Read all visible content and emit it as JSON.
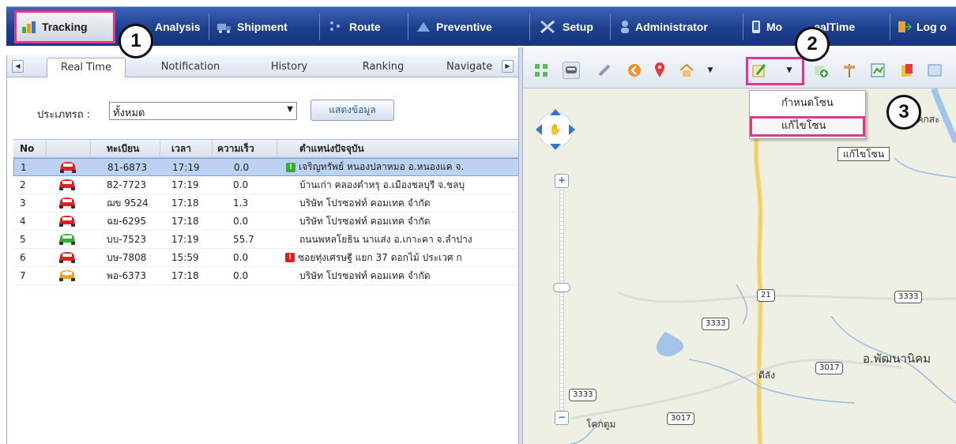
{
  "menu": {
    "tracking": "Tracking",
    "analysis": "Analysis",
    "shipment": "Shipment",
    "route": "Route",
    "preventive": "Preventive",
    "setup": "Setup",
    "administrator": "Administrator",
    "mobile_realtime_a": "Mo",
    "mobile_realtime_b": "ealTime",
    "logout": "Log o"
  },
  "callouts": {
    "one": "1",
    "two": "2",
    "three": "3"
  },
  "tabs": [
    "Real Time",
    "Notification",
    "History",
    "Ranking",
    "Navigate"
  ],
  "filter": {
    "label": "ประเภทรถ :",
    "selected": "ทั้งหมด",
    "button": "แสดงข้อมูล"
  },
  "grid": {
    "headers": {
      "no": "No",
      "plate": "ทะเบียน",
      "time": "เวลา",
      "speed": "ความเร็ว",
      "location": "ตำแหน่งปัจจุบัน"
    },
    "rows": [
      {
        "no": "1",
        "plate": "81-6873",
        "time": "17:19",
        "speed": "0.0",
        "location": "เจริญทรัพย์ หนองปลาหมอ อ.หนองแค จ.",
        "car": "red",
        "warn": "green"
      },
      {
        "no": "2",
        "plate": "82-7723",
        "time": "17:19",
        "speed": "0.0",
        "location": "บ้านเก่า คลองตำหรุ อ.เมืองชลบุรี จ.ชลบุ",
        "car": "red",
        "warn": ""
      },
      {
        "no": "3",
        "plate": "ฌข 9524",
        "time": "17:18",
        "speed": "1.3",
        "location": "บริษัท โปรซอฟท์ คอมเทค จำกัด",
        "car": "red",
        "warn": ""
      },
      {
        "no": "4",
        "plate": "ฉย-6295",
        "time": "17:18",
        "speed": "0.0",
        "location": "บริษัท โปรซอฟท์ คอมเทค จำกัด",
        "car": "red",
        "warn": ""
      },
      {
        "no": "5",
        "plate": "บบ-7523",
        "time": "17:19",
        "speed": "55.7",
        "location": "ถนนพหลโยธิน นาแส่ง อ.เกาะคา จ.ลำปาง",
        "car": "green",
        "warn": ""
      },
      {
        "no": "6",
        "plate": "บษ-7808",
        "time": "15:59",
        "speed": "0.0",
        "location": "ซอยทุ่งเศรษฐี แยก 37 ดอกไม้ ประเวศ ก",
        "car": "red",
        "warn": "red"
      },
      {
        "no": "7",
        "plate": "พอ-6373",
        "time": "17:18",
        "speed": "0.0",
        "location": "บริษัท โปรซอฟท์ คอมเทค จำกัด",
        "car": "orange",
        "warn": ""
      }
    ]
  },
  "zone_menu": {
    "define": "กำหนดโซน",
    "edit": "แก้ไขโซน",
    "tooltip": "แก้ไขโซน"
  },
  "map_labels": {
    "top_right": "โคกสะ",
    "phanat_nikhom": "อ.พัฒนานิคม",
    "dilang": "ดีลัง",
    "khok_tum": "โคกตูม",
    "road_21": "21",
    "road_3333a": "3333",
    "road_3333b": "3333",
    "road_3333c": "3333",
    "road_3017a": "3017",
    "road_3017b": "3017"
  },
  "colors": {
    "brand": "#1d3f8c",
    "highlight": "#e6338c",
    "selected_row": "#bdd2f2"
  }
}
